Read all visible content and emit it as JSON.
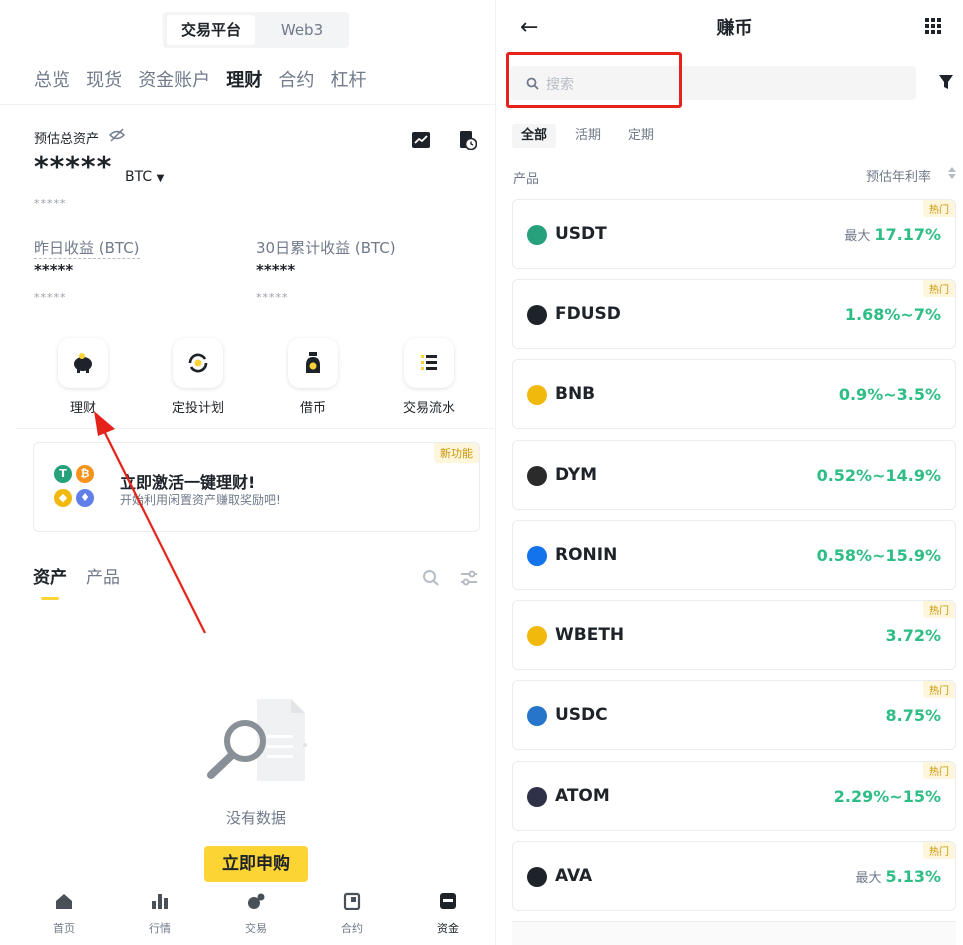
{
  "left": {
    "toggle": {
      "active": "交易平台",
      "inactive": "Web3"
    },
    "nav_tabs": [
      "总览",
      "现货",
      "资金账户",
      "理财",
      "合约",
      "杠杆"
    ],
    "assets": {
      "label": "预估总资产",
      "value_masked": "*****",
      "unit": "BTC",
      "sub_masked": "*****",
      "yesterday_label": "昨日收益 (BTC)",
      "yesterday_value": "*****",
      "yesterday_sub": "*****",
      "month_label": "30日累计收益 (BTC)",
      "month_value": "*****",
      "month_sub": "*****"
    },
    "quick_actions": [
      "理财",
      "定投计划",
      "借币",
      "交易流水"
    ],
    "promo": {
      "badge": "新功能",
      "title": "立即激活一键理财!",
      "subtitle": "开始利用闲置资产赚取奖励吧!"
    },
    "sub_tabs": [
      "资产",
      "产品"
    ],
    "empty_text": "没有数据",
    "subscribe_button": "立即申购",
    "bottom_nav": [
      "首页",
      "行情",
      "交易",
      "合约",
      "资金"
    ]
  },
  "right": {
    "title": "赚币",
    "search_placeholder": "搜索",
    "filter_tabs": [
      "全部",
      "活期",
      "定期"
    ],
    "col_product": "产品",
    "col_rate": "预估年利率",
    "products": [
      {
        "name": "USDT",
        "prefix": "最大",
        "rate": "17.17%",
        "hot": "热门",
        "color": "#26a17b"
      },
      {
        "name": "FDUSD",
        "prefix": "",
        "rate": "1.68%~7%",
        "hot": "热门",
        "color": "#1e2329"
      },
      {
        "name": "BNB",
        "prefix": "",
        "rate": "0.9%~3.5%",
        "hot": "",
        "color": "#f0b90b"
      },
      {
        "name": "DYM",
        "prefix": "",
        "rate": "0.52%~14.9%",
        "hot": "",
        "color": "#2b2b2b"
      },
      {
        "name": "RONIN",
        "prefix": "",
        "rate": "0.58%~15.9%",
        "hot": "",
        "color": "#1273ea"
      },
      {
        "name": "WBETH",
        "prefix": "",
        "rate": "3.72%",
        "hot": "热门",
        "color": "#f0b90b"
      },
      {
        "name": "USDC",
        "prefix": "",
        "rate": "8.75%",
        "hot": "热门",
        "color": "#2775ca"
      },
      {
        "name": "ATOM",
        "prefix": "",
        "rate": "2.29%~15%",
        "hot": "热门",
        "color": "#2e3148"
      },
      {
        "name": "AVA",
        "prefix": "最大",
        "rate": "5.13%",
        "hot": "热门",
        "color": "#1e2329"
      }
    ]
  },
  "colors": {
    "brand": "#fcd535",
    "positive": "#2ebd85",
    "annotation": "#e5231b"
  }
}
